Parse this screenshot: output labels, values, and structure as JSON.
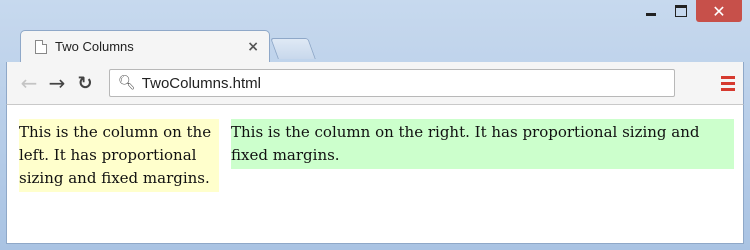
{
  "window": {
    "caption_buttons": [
      "minimize",
      "maximize",
      "close"
    ]
  },
  "tab": {
    "title": "Two Columns",
    "icon": "document-icon",
    "close_label": "×"
  },
  "toolbar": {
    "back_icon": "arrow-left-icon",
    "forward_icon": "arrow-right-icon",
    "reload_icon": "reload-icon",
    "url": "TwoColumns.html",
    "menu_icon": "hamburger-menu-icon",
    "menu_color": "#d63a2f"
  },
  "page": {
    "left_column_text": "This is the column on the left. It has proportional sizing and fixed margins.",
    "right_column_text": "This is the column on the right. It has proportional sizing and fixed margins.",
    "left_bg": "#ffffcc",
    "right_bg": "#ccffcc"
  }
}
